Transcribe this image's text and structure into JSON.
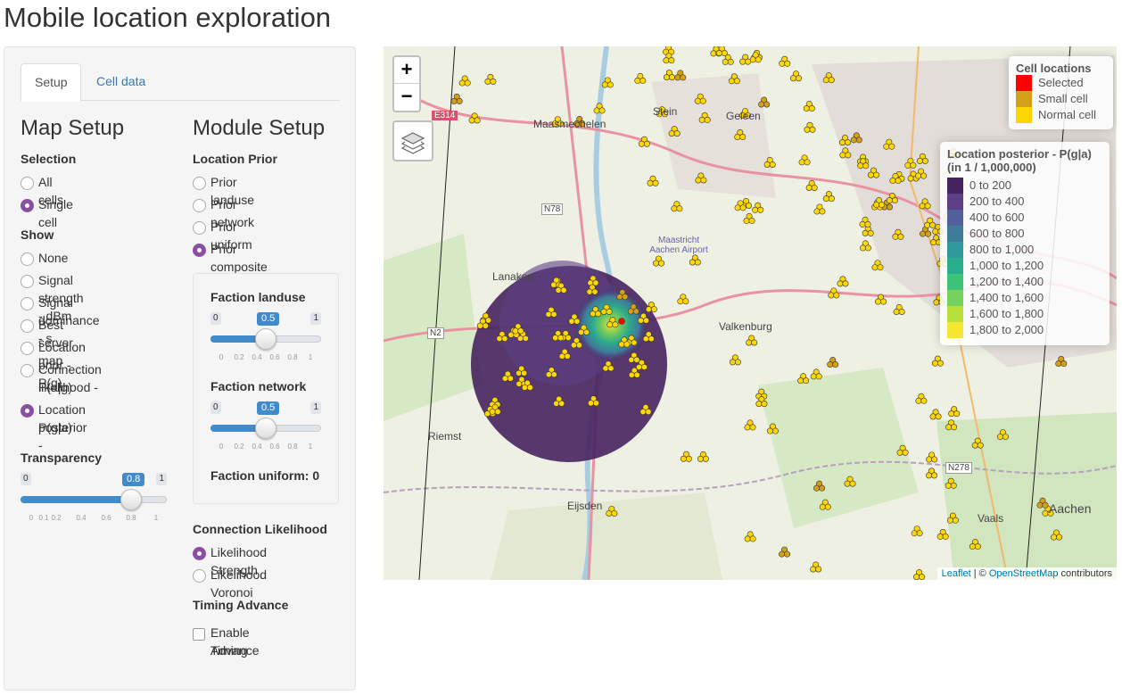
{
  "page_title": "Mobile location exploration",
  "tabs": [
    {
      "label": "Setup",
      "active": true
    },
    {
      "label": "Cell data",
      "active": false
    }
  ],
  "map_setup": {
    "heading": "Map Setup",
    "selection_label": "Selection",
    "selection_options": [
      {
        "label": "All cells",
        "checked": false
      },
      {
        "label": "Single cell",
        "checked": true
      }
    ],
    "show_label": "Show",
    "show_options": [
      {
        "label": "None",
        "checked": false
      },
      {
        "label": "Signal strength - dBm",
        "checked": false
      },
      {
        "label": "Signal dominance - s",
        "checked": false
      },
      {
        "label": "Best server map",
        "checked": false
      },
      {
        "label": "Location prior - P(g)",
        "checked": false
      },
      {
        "label": "Connection likelihood -",
        "label2": "P(a|g)",
        "checked": false
      },
      {
        "label": "Location posterior -",
        "label2": "P(g|a)",
        "checked": true
      }
    ],
    "transparency": {
      "label": "Transparency",
      "min": "0",
      "max": "1",
      "value": "0.8",
      "fraction": 0.8,
      "ticks": [
        "0",
        "0.1",
        "0.2",
        "0.4",
        "0.6",
        "0.8",
        "1"
      ]
    }
  },
  "module_setup": {
    "heading": "Module Setup",
    "location_prior_label": "Location Prior",
    "prior_options": [
      {
        "label": "Prior landuse",
        "checked": false
      },
      {
        "label": "Prior network",
        "checked": false
      },
      {
        "label": "Prior uniform",
        "checked": false
      },
      {
        "label": "Prior composite",
        "checked": true
      }
    ],
    "faction_landuse": {
      "label": "Faction landuse",
      "min": "0",
      "max": "1",
      "value": "0.5",
      "fraction": 0.5,
      "ticks": [
        "0",
        "0.2",
        "0.4",
        "0.6",
        "0.8",
        "1"
      ]
    },
    "faction_network": {
      "label": "Faction network",
      "min": "0",
      "max": "1",
      "value": "0.5",
      "fraction": 0.5,
      "ticks": [
        "0",
        "0.2",
        "0.4",
        "0.6",
        "0.8",
        "1"
      ]
    },
    "faction_uniform": "Faction uniform: 0",
    "connection_likelihood_label": "Connection Likelihood",
    "likelihood_options": [
      {
        "label": "Likelihood Strength",
        "checked": true
      },
      {
        "label": "Likelihood Voronoi",
        "checked": false
      }
    ],
    "timing_advance_label": "Timing Advance",
    "timing_advance_checkbox": {
      "label": "Enable Timing",
      "label2": "Advance",
      "checked": false
    }
  },
  "map": {
    "zoom_in": "+",
    "zoom_out": "−",
    "layers_icon": "layers-icon",
    "cell_legend": {
      "title": "Cell locations",
      "items": [
        {
          "label": "Selected",
          "color": "#ff0000"
        },
        {
          "label": "Small cell",
          "color": "#d4a017"
        },
        {
          "label": "Normal cell",
          "color": "#ffd700"
        }
      ]
    },
    "posterior_legend": {
      "title": "Location posterior - P(g|a)",
      "subtitle": "(in 1 / 1,000,000)",
      "items": [
        {
          "label": "0 to 200",
          "color": "#46225e"
        },
        {
          "label": "200 to 400",
          "color": "#5c3f86"
        },
        {
          "label": "400 to 600",
          "color": "#51609a"
        },
        {
          "label": "600 to 800",
          "color": "#3f7c9c"
        },
        {
          "label": "800 to 1,000",
          "color": "#31989b"
        },
        {
          "label": "1,000 to 1,200",
          "color": "#2aae8e"
        },
        {
          "label": "1,200 to 1,400",
          "color": "#3dc27a"
        },
        {
          "label": "1,400 to 1,600",
          "color": "#76d25c"
        },
        {
          "label": "1,600 to 1,800",
          "color": "#b9df3a"
        },
        {
          "label": "1,800 to 2,000",
          "color": "#f5e731"
        }
      ]
    },
    "place_labels": [
      "Maasmechelen",
      "Stein",
      "Geleen",
      "Lanaken",
      "Maastricht Aachen Airport",
      "Valkenburg",
      "Riemst",
      "Eijsden",
      "Aachen",
      "Vaals",
      "N78",
      "N2",
      "N278",
      "E314"
    ],
    "attribution": {
      "leaflet": "Leaflet",
      "sep": " | © ",
      "osm": "OpenStreetMap",
      "suffix": " contributors"
    }
  }
}
